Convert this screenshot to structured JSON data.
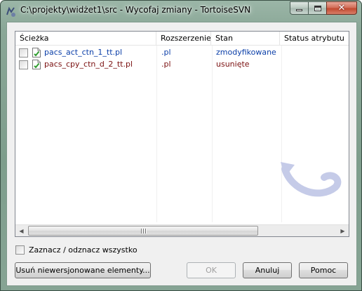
{
  "window": {
    "title": "C:\\projekty\\widżet1\\src - Wycofaj zmiany - TortoiseSVN"
  },
  "list": {
    "columns": [
      "Ścieżka",
      "Rozszerzenie",
      "Stan",
      "Status atrybutu"
    ],
    "rows": [
      {
        "path": "pacs_act_ctn_1_tt.pl",
        "extension": ".pl",
        "status": "zmodyfikowane",
        "checked": false,
        "color": "#0a3ea8"
      },
      {
        "path": "pacs_cpy_ctn_d_2_tt.pl",
        "extension": ".pl",
        "status": "usunięte",
        "checked": false,
        "color": "#7a1010"
      }
    ]
  },
  "select_all": {
    "label": "Zaznacz / odznacz wszystko",
    "checked": false
  },
  "buttons": {
    "remove_unversioned": "Usuń niewersjonowane elementy...",
    "ok": "OK",
    "cancel": "Anuluj",
    "help": "Pomoc"
  },
  "colors": {
    "modified": "#0a3ea8",
    "deleted": "#7a1010",
    "titlebar": "#8aa797"
  }
}
